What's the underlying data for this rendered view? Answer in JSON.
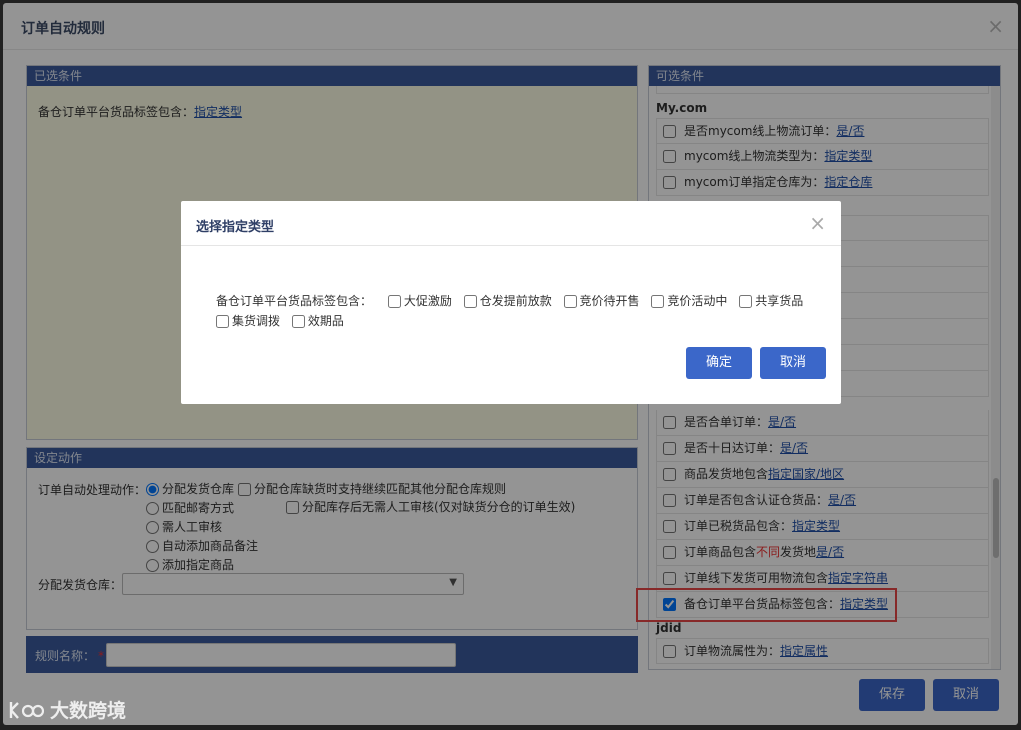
{
  "outer": {
    "title": "订单自动规则",
    "close_glyph": "×"
  },
  "selected_panel": {
    "title": "已选条件",
    "condition_label": "备仓订单平台货品标签包含：",
    "condition_link": "指定类型"
  },
  "action_panel": {
    "title": "设定动作",
    "process_label": "订单自动处理动作：",
    "options": [
      "分配发货仓库",
      "匹配邮寄方式",
      "需人工审核",
      "自动添加商品备注",
      "添加指定商品"
    ],
    "selected_option": "分配发货仓库",
    "extra_checks": [
      "分配仓库缺货时支持继续匹配其他分配仓库规则",
      "分配库存后无需人工审核(仅对缺货分仓的订单生效)"
    ],
    "warehouse_label": "分配发货仓库：",
    "warehouse_value": ""
  },
  "rule_name": {
    "label": "规则名称：",
    "required_mark": "*",
    "value": ""
  },
  "available_panel": {
    "title": "可选条件",
    "groups": [
      {
        "title": "My.com",
        "rows": [
          {
            "label": "是否mycom线上物流订单：",
            "link": "是/否",
            "checked": false
          },
          {
            "label": "mycom线上物流类型为：",
            "link": "指定类型",
            "checked": false
          },
          {
            "label": "mycom订单指定仓库为：",
            "link": "指定仓库",
            "checked": false
          }
        ]
      },
      {
        "title": "",
        "rows": [
          {
            "label": "是否合单订单：",
            "link": "是/否",
            "checked": false
          },
          {
            "label": "是否十日达订单：",
            "link": "是/否",
            "checked": false
          },
          {
            "label": "商品发货地包含",
            "link": "指定国家/地区",
            "checked": false
          },
          {
            "label": "订单是否包含认证仓货品：",
            "link": "是/否",
            "checked": false
          },
          {
            "label": "订单已税货品包含：",
            "link": "指定类型",
            "checked": false
          },
          {
            "label": "订单商品包含",
            "label_red": "不同",
            "label_after": "发货地",
            "link": "是/否",
            "checked": false
          },
          {
            "label": "订单线下发货可用物流包含",
            "link": "指定字符串",
            "checked": false
          },
          {
            "label": "备仓订单平台货品标签包含：",
            "link": "指定类型",
            "checked": true
          }
        ]
      },
      {
        "title": "jdid",
        "rows": [
          {
            "label": "订单物流属性为：",
            "link": "指定属性",
            "checked": false
          }
        ]
      }
    ]
  },
  "buttons": {
    "save": "保存",
    "cancel": "取消"
  },
  "dialog": {
    "title": "选择指定类型",
    "close_glyph": "×",
    "label": "备仓订单平台货品标签包含：",
    "options": [
      "大促激励",
      "仓发提前放款",
      "竞价待开售",
      "竞价活动中",
      "共享货品",
      "集货调拨",
      "效期品"
    ],
    "ok": "确定",
    "cancel": "取消"
  },
  "watermark": {
    "text": "大数跨境"
  },
  "colors": {
    "header_blue": "#3c5b9e",
    "button_blue": "#3b67c9",
    "highlight_red": "#e84848",
    "selected_bg": "#fdfde6"
  }
}
